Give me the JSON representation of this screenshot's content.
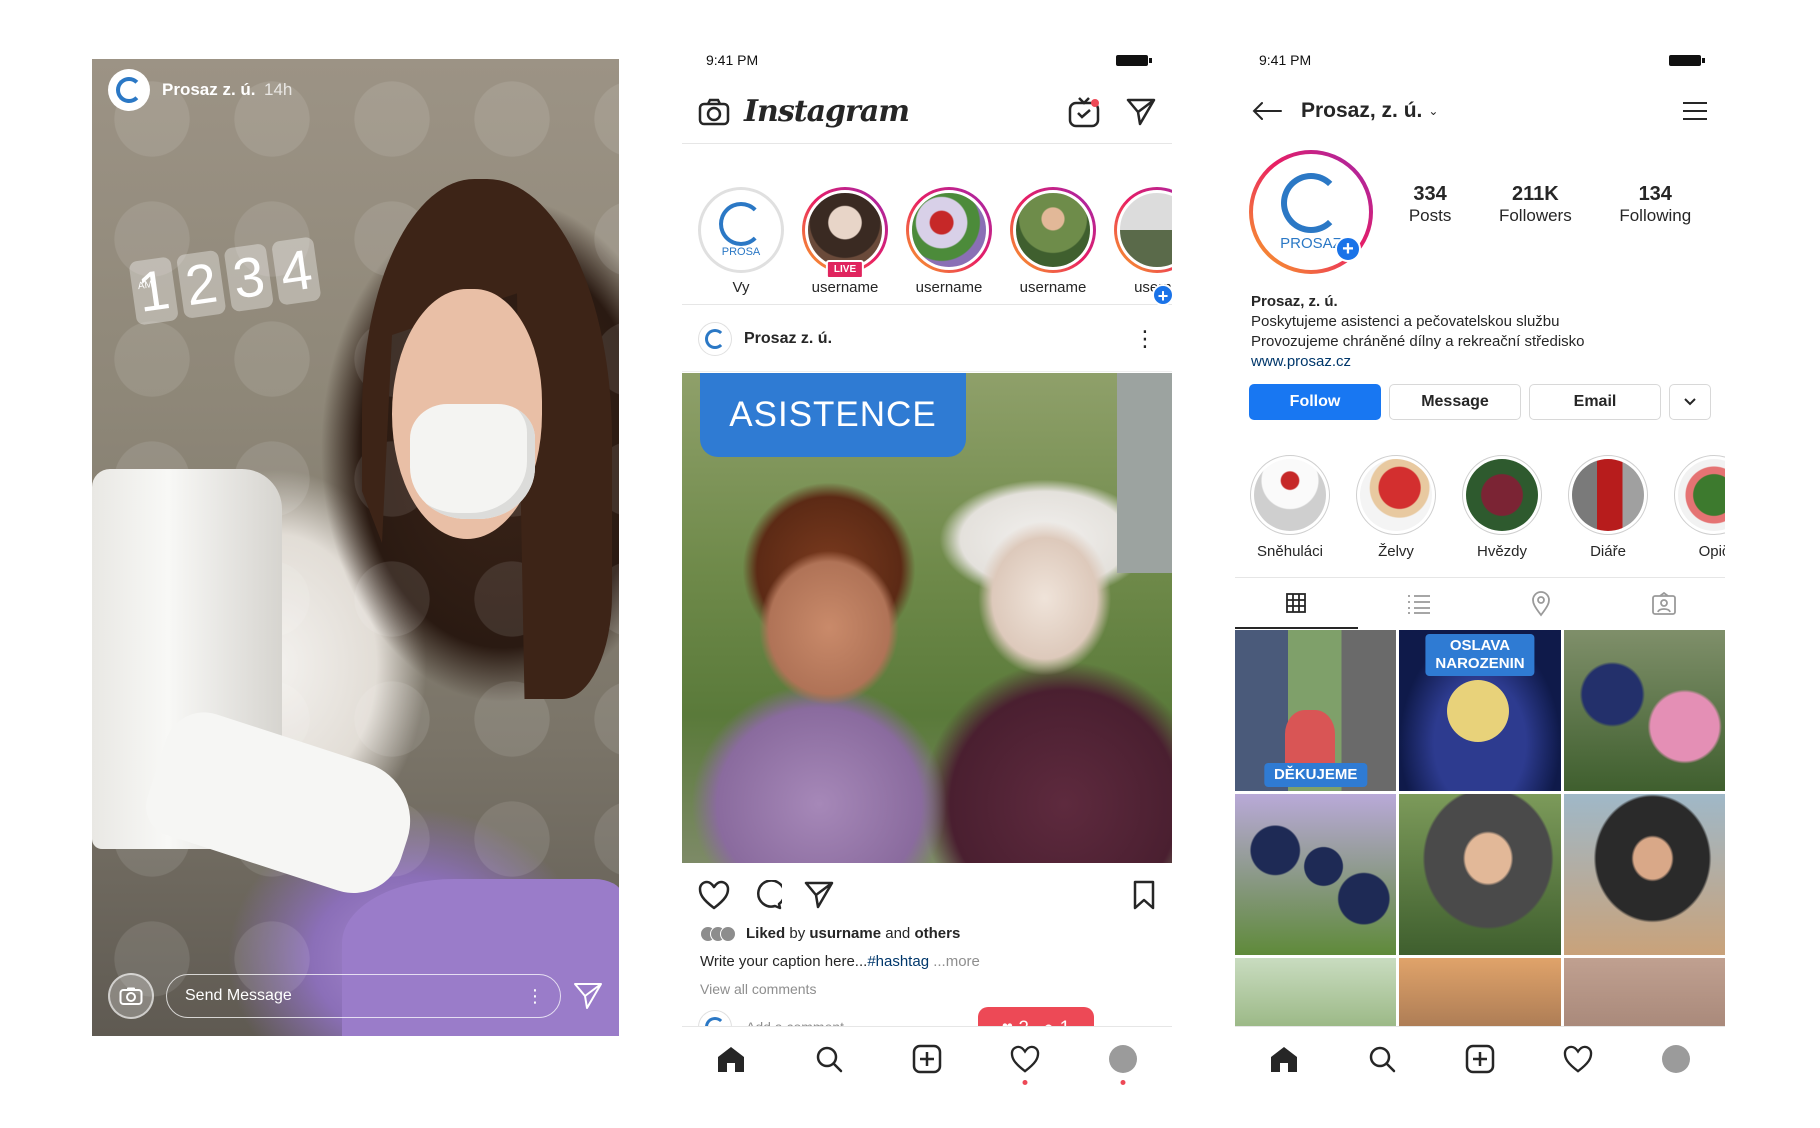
{
  "story": {
    "account_name": "Prosaz z. ú.",
    "posted_ago": "14h",
    "clock_sticker": {
      "digits": [
        "1",
        "2",
        "3",
        "4"
      ],
      "period": "AM"
    },
    "reply_placeholder": "Send Message",
    "icons": [
      "camera-icon",
      "more-icon",
      "send-icon"
    ]
  },
  "feed": {
    "status_time": "9:41 PM",
    "app_name": "Instagram",
    "icons": [
      "camera-icon",
      "igtv-icon",
      "direct-icon"
    ],
    "stories": [
      {
        "label": "Vy",
        "own": true,
        "logo_text": "PROSA"
      },
      {
        "label": "username",
        "live": true,
        "live_text": "LIVE"
      },
      {
        "label": "username"
      },
      {
        "label": "username"
      },
      {
        "label": "userna"
      }
    ],
    "post": {
      "account_name": "Prosaz z. ú.",
      "banner_text": "ASISTENCE",
      "liked_by_prefix": "Liked",
      "liked_by_mid": "by",
      "liked_by_user": "usurname",
      "liked_by_and": "and",
      "liked_by_others": "others",
      "caption_text": "Write your caption here...",
      "caption_hashtag": "#hashtag",
      "caption_more": "...more",
      "view_all_comments": "View all comments",
      "add_comment_placeholder": "Add a comment..."
    },
    "notification": {
      "likes": "2",
      "comments": "1"
    },
    "tabbar": [
      "home-icon",
      "search-icon",
      "new-post-icon",
      "activity-icon",
      "profile-icon"
    ]
  },
  "profile": {
    "status_time": "9:41 PM",
    "username": "Prosaz, z. ú.",
    "logo_text": "PROSAZ",
    "stats": [
      {
        "value": "334",
        "label": "Posts"
      },
      {
        "value": "211K",
        "label": "Followers"
      },
      {
        "value": "134",
        "label": "Following"
      }
    ],
    "bio": {
      "name": "Prosaz, z. ú.",
      "line1": "Poskytujeme asistenci a pečovatelskou službu",
      "line2": "Provozujeme chráněné dílny a rekreační středisko",
      "link": "www.prosaz.cz"
    },
    "buttons": {
      "follow": "Follow",
      "message": "Message",
      "email": "Email"
    },
    "highlights": [
      {
        "label": "Sněhuláci",
        "color": "#d9d9d9"
      },
      {
        "label": "Želvy",
        "color": "#c62828"
      },
      {
        "label": "Hvězdy",
        "color": "#8e2c3a"
      },
      {
        "label": "Diáře",
        "color": "#b71c1c"
      },
      {
        "label": "Opič",
        "color": "#4c8b3a"
      }
    ],
    "grid_tabs": [
      "grid-icon",
      "list-icon",
      "location-icon",
      "tagged-icon"
    ],
    "grid_labels": {
      "thanks": "DĚKUJEME",
      "birthday_line1": "OSLAVA",
      "birthday_line2": "NAROZENIN"
    }
  },
  "colors": {
    "brand_blue": "#2f7bd3",
    "follow_blue": "#1877f2",
    "notification_red": "#ed4956"
  }
}
